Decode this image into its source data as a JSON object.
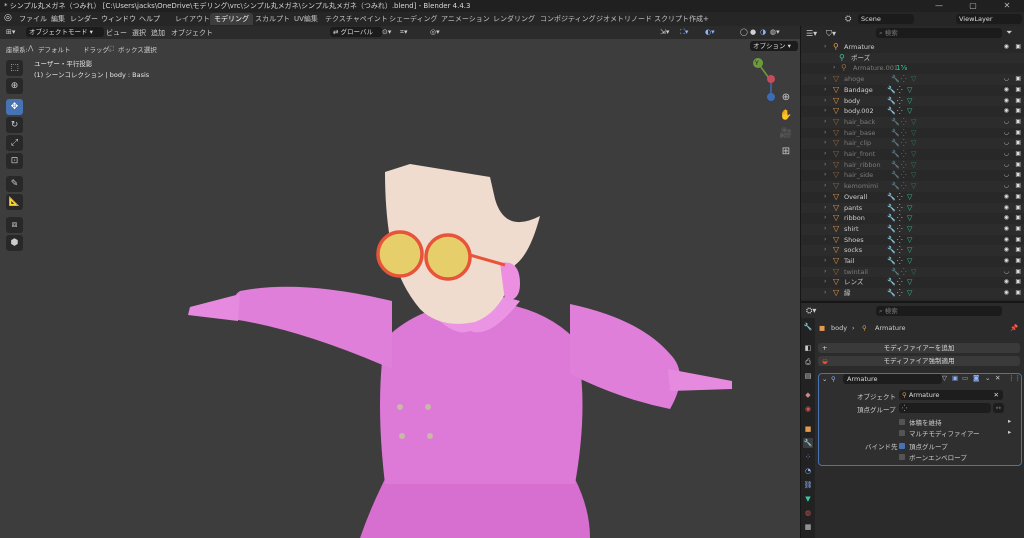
{
  "window": {
    "title": "* シンプル丸メガネ（つみれ） [C:\\Users\\jacks\\OneDrive\\モデリング\\vrc\\シンプル丸メガネ\\シンプル丸メガネ（つみれ）.blend] - Blender 4.4.3",
    "minimize": "—",
    "maximize": "▢",
    "close": "✕"
  },
  "menu": {
    "items": [
      "ファイル",
      "編集",
      "レンダー",
      "ウィンドウ",
      "ヘルプ"
    ],
    "workspaces": [
      "レイアウト",
      "モデリング",
      "スカルプト",
      "UV編集",
      "テクスチャペイント",
      "シェーディング",
      "アニメーション",
      "レンダリング",
      "コンポジティング",
      "ジオメトリノード",
      "スクリプト作成"
    ],
    "add_tab": "+",
    "scene_label": "Scene",
    "viewlayer_label": "ViewLayer"
  },
  "viewport_header": {
    "mode": "オブジェクトモード",
    "menus": [
      "ビュー",
      "選択",
      "追加",
      "オブジェクト"
    ],
    "orientation": "グローバル",
    "coord_label": "座標系:",
    "coord_value": "デフォルト",
    "drag_label": "ドラッグ:",
    "drag_value": "ボックス選択",
    "options": "オプション"
  },
  "viewport": {
    "view_name": "ユーザー・平行投影",
    "collection_info": "(1) シーンコレクション | body : Basis",
    "gizmo_x": "X",
    "gizmo_y": "Y",
    "gizmo_z": "Z"
  },
  "outliner": {
    "search_placeholder": "検索",
    "rows": [
      {
        "name": "Armature",
        "dim": false,
        "vis": true
      },
      {
        "name": "ポーズ",
        "dim": false,
        "vis": false
      },
      {
        "name": "Armature.001",
        "dim": true,
        "vis": false
      },
      {
        "name": "ahoge",
        "dim": true,
        "vis": true
      },
      {
        "name": "Bandage",
        "dim": false,
        "vis": true
      },
      {
        "name": "body",
        "dim": false,
        "vis": true
      },
      {
        "name": "body.002",
        "dim": false,
        "vis": true
      },
      {
        "name": "hair_back",
        "dim": true,
        "vis": true
      },
      {
        "name": "hair_base",
        "dim": true,
        "vis": true
      },
      {
        "name": "hair_clip",
        "dim": true,
        "vis": true
      },
      {
        "name": "hair_front",
        "dim": true,
        "vis": true
      },
      {
        "name": "hair_ribbon",
        "dim": true,
        "vis": true
      },
      {
        "name": "hair_side",
        "dim": true,
        "vis": true
      },
      {
        "name": "kemomimi",
        "dim": true,
        "vis": true
      },
      {
        "name": "Overall",
        "dim": false,
        "vis": true
      },
      {
        "name": "pants",
        "dim": false,
        "vis": true
      },
      {
        "name": "ribbon",
        "dim": false,
        "vis": true
      },
      {
        "name": "shirt",
        "dim": false,
        "vis": true
      },
      {
        "name": "Shoes",
        "dim": false,
        "vis": true
      },
      {
        "name": "socks",
        "dim": false,
        "vis": true
      },
      {
        "name": "Tail",
        "dim": false,
        "vis": true
      },
      {
        "name": "twintail",
        "dim": true,
        "vis": true
      },
      {
        "name": "レンズ",
        "dim": false,
        "vis": true
      },
      {
        "name": "縁",
        "dim": false,
        "vis": true
      }
    ],
    "armature_badge": "1⅝"
  },
  "properties": {
    "search_placeholder": "検索",
    "breadcrumb_object": "body",
    "breadcrumb_sep": "›",
    "breadcrumb_modifier": "Armature",
    "add_modifier": "モディファイアーを追加",
    "apply_modifier": "モディファイア強制適用",
    "modifier_name": "Armature",
    "object_label": "オブジェクト",
    "object_value": "Armature",
    "vertex_group_label": "頂点グループ",
    "preserve_volume": "体積を維持",
    "multi_modifier": "マルチモディファイアー",
    "bind_to_label": "バインド先",
    "bind_vertex_groups": "頂点グループ",
    "bind_bone_envelopes": "ボーンエンベロープ"
  },
  "colors": {
    "accent": "#4772b3",
    "viewport_bg": "#3d3d3d",
    "character_pink": "#e07fd9",
    "glasses_frame": "#e8543a",
    "lens_yellow": "#e6cf6a",
    "object_orange": "#e59b4f",
    "mesh_teal": "#38c9a0"
  }
}
